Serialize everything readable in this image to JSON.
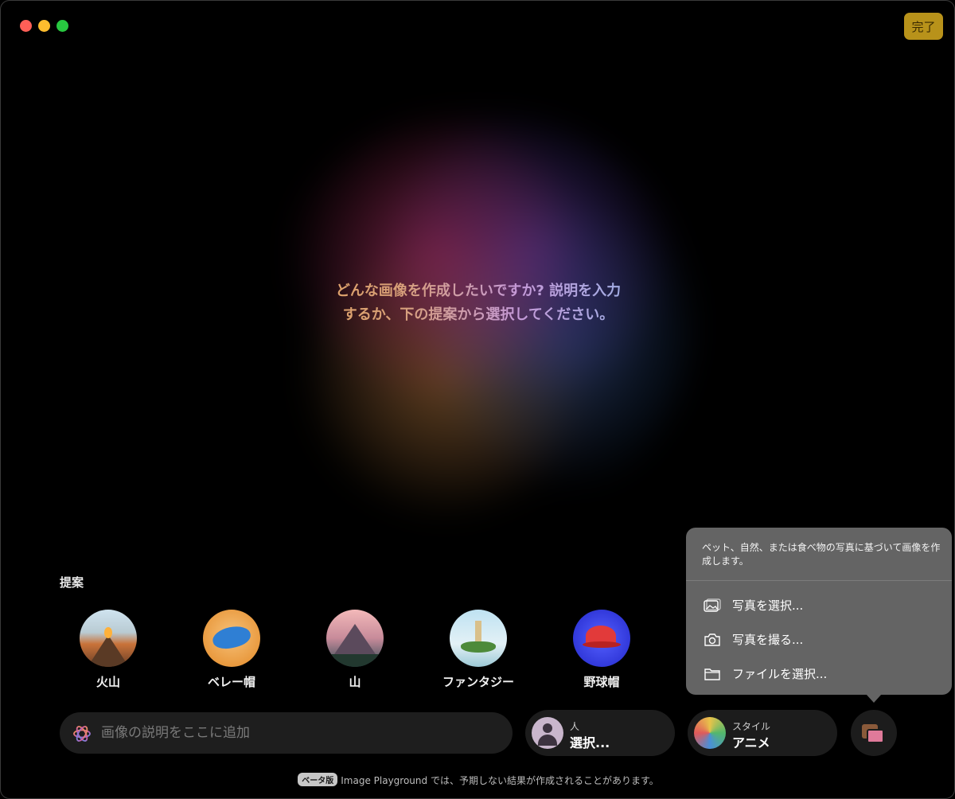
{
  "window": {
    "done_label": "完了"
  },
  "prompt": {
    "line1": "どんな画像を作成したいですか? 説明を入力",
    "line2": "するか、下の提案から選択してください。"
  },
  "suggestions": {
    "title": "提案",
    "items": [
      {
        "label": "火山",
        "icon": "volcano-thumbnail"
      },
      {
        "label": "ベレー帽",
        "icon": "beret-thumbnail"
      },
      {
        "label": "山",
        "icon": "mountain-thumbnail"
      },
      {
        "label": "ファンタジー",
        "icon": "fantasy-thumbnail"
      },
      {
        "label": "野球帽",
        "icon": "baseball-cap-thumbnail"
      }
    ]
  },
  "popover": {
    "description": "ペット、自然、または食べ物の写真に基づいて画像を作成します。",
    "items": [
      {
        "label": "写真を選択...",
        "icon": "photo-icon"
      },
      {
        "label": "写真を撮る...",
        "icon": "camera-icon"
      },
      {
        "label": "ファイルを選択...",
        "icon": "folder-icon"
      }
    ]
  },
  "bottom_bar": {
    "search_placeholder": "画像の説明をここに追加",
    "person": {
      "small": "人",
      "big": "選択..."
    },
    "style": {
      "small": "スタイル",
      "big": "アニメ"
    }
  },
  "footer": {
    "badge": "ベータ版",
    "text": "Image Playground では、予期しない結果が作成されることがあります。"
  },
  "colors": {
    "done_button": "#b8921a",
    "popover_bg": "#646464",
    "pill_bg": "#1c1c1c"
  }
}
